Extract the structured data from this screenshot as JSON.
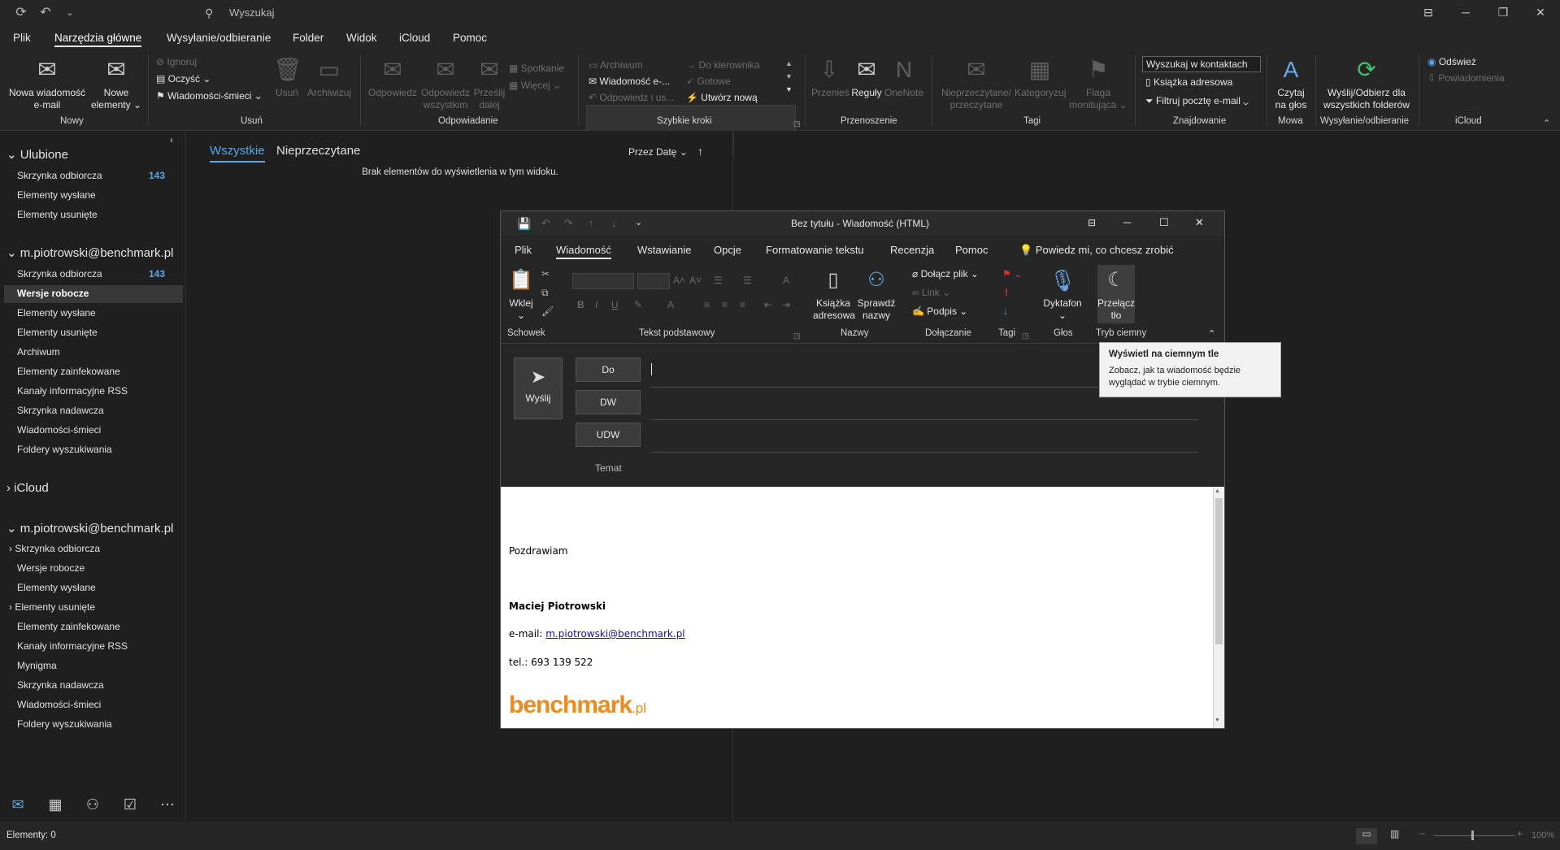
{
  "titlebar": {
    "search_placeholder": "Wyszukaj"
  },
  "menu": [
    "Plik",
    "Narzędzia główne",
    "Wysyłanie/odbieranie",
    "Folder",
    "Widok",
    "iCloud",
    "Pomoc"
  ],
  "ribbon": {
    "new_email": [
      "Nowa wiadomość",
      "e-mail"
    ],
    "new_items": [
      "Nowe",
      "elementy ⌄"
    ],
    "ignore": "Ignoruj",
    "cleanup": "Oczyść ⌄",
    "junk": "Wiadomości-śmieci ⌄",
    "delete": "Usuń",
    "archive": "Archiwizuj",
    "reply": "Odpowiedz",
    "reply_all": [
      "Odpowiedz",
      "wszystkim"
    ],
    "forward": [
      "Prześlij",
      "dalej"
    ],
    "meeting": "Spotkanie",
    "more": "Więcej ⌄",
    "qs_archive": "Archiwum",
    "qs_manager": "Do kierownika",
    "qs_email": "Wiadomość e-...",
    "qs_done": "Gotowe",
    "qs_reply_delete": "Odpowiedz i us...",
    "qs_create_new": "Utwórz nową",
    "move": "Przenieś",
    "rules": "Reguły",
    "onenote": "OneNote",
    "unread_read": [
      "Nieprzeczytane/",
      "przeczytane"
    ],
    "categorize": "Kategoryzuj",
    "flag": [
      "Flaga",
      "monitująca ⌄"
    ],
    "search_contacts": "Wyszukaj w kontaktach",
    "address_book": "Książka adresowa",
    "filter_email": "Filtruj pocztę e-mail ⌄",
    "read_aloud": [
      "Czytaj",
      "na głos"
    ],
    "send_receive_all": [
      "Wyślij/Odbierz dla",
      "wszystkich folderów"
    ],
    "refresh": "Odśwież",
    "notifications": "Powiadomienia",
    "groups": {
      "new": "Nowy",
      "delete": "Usuń",
      "respond": "Odpowiadanie",
      "quick_steps": "Szybkie kroki",
      "move": "Przenoszenie",
      "tags": "Tagi",
      "find": "Znajdowanie",
      "speech": "Mowa",
      "send_receive": "Wysyłanie/odbieranie",
      "icloud": "iCloud"
    }
  },
  "folders": {
    "favorites": {
      "header": "Ulubione",
      "items": [
        {
          "label": "Skrzynka odbiorcza",
          "count": "143"
        },
        {
          "label": "Elementy wysłane",
          "count": ""
        },
        {
          "label": "Elementy usunięte",
          "count": ""
        }
      ]
    },
    "account1": {
      "header": "m.piotrowski@benchmark.pl",
      "items": [
        {
          "label": "Skrzynka odbiorcza",
          "count": "143"
        },
        {
          "label": "Wersje robocze",
          "count": ""
        },
        {
          "label": "Elementy wysłane",
          "count": ""
        },
        {
          "label": "Elementy usunięte",
          "count": ""
        },
        {
          "label": "Archiwum",
          "count": ""
        },
        {
          "label": "Elementy zainfekowane",
          "count": ""
        },
        {
          "label": "Kanały informacyjne RSS",
          "count": ""
        },
        {
          "label": "Skrzynka nadawcza",
          "count": ""
        },
        {
          "label": "Wiadomości-śmieci",
          "count": ""
        },
        {
          "label": "Foldery wyszukiwania",
          "count": ""
        }
      ]
    },
    "icloud": {
      "header": "iCloud"
    },
    "account2": {
      "header": "m.piotrowski@benchmark.pl",
      "items": [
        {
          "label": "Skrzynka odbiorcza"
        },
        {
          "label": "Wersje robocze"
        },
        {
          "label": "Elementy wysłane"
        },
        {
          "label": "Elementy usunięte"
        },
        {
          "label": "Elementy zainfekowane"
        },
        {
          "label": "Kanały informacyjne RSS"
        },
        {
          "label": "Mynigma"
        },
        {
          "label": "Skrzynka nadawcza"
        },
        {
          "label": "Wiadomości-śmieci"
        },
        {
          "label": "Foldery wyszukiwania"
        }
      ]
    }
  },
  "list": {
    "tab_all": "Wszystkie",
    "tab_unread": "Nieprzeczytane",
    "sort": "Przez Datę",
    "empty": "Brak elementów do wyświetlenia w tym widoku."
  },
  "status": {
    "items": "Elementy: 0",
    "zoom": "100%"
  },
  "compose": {
    "title": "Bez tytułu  -  Wiadomość (HTML)",
    "menu": [
      "Plik",
      "Wiadomość",
      "Wstawianie",
      "Opcje",
      "Formatowanie tekstu",
      "Recenzja",
      "Pomoc"
    ],
    "tell_me": "Powiedz mi, co chcesz zrobić",
    "paste": "Wklej",
    "address_book": [
      "Książka",
      "adresowa"
    ],
    "check_names": [
      "Sprawdź",
      "nazwy"
    ],
    "attach_file": "Dołącz plik ⌄",
    "link": "Link ⌄",
    "signature": "Podpis ⌄",
    "dictate": "Dyktafon",
    "toggle_bg": [
      "Przełącz",
      "tło"
    ],
    "groups": {
      "clipboard": "Schowek",
      "basic_text": "Tekst podstawowy",
      "names": "Nazwy",
      "include": "Dołączanie",
      "tags": "Tagi",
      "voice": "Głos",
      "dark_mode": "Tryb ciemny"
    },
    "send": "Wyślij",
    "to": "Do",
    "cc": "DW",
    "bcc": "UDW",
    "subject": "Temat",
    "body": {
      "greeting": "Pozdrawiam",
      "name": "Maciej Piotrowski",
      "email_label": "e-mail: ",
      "email": "m.piotrowski@benchmark.pl",
      "phone": "tel.: 693 139 522",
      "logo_main": "benchmark",
      "logo_suffix": ".pl"
    }
  },
  "tooltip": {
    "title": "Wyświetl na ciemnym tle",
    "text": "Zobacz, jak ta wiadomość będzie wyglądać w trybie ciemnym."
  }
}
